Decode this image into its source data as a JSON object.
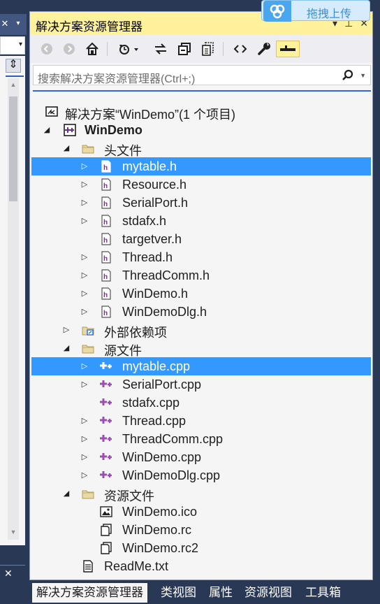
{
  "explorer": {
    "title": "解决方案资源管理器",
    "title_buttons": [
      "▾",
      "⊥",
      "✕"
    ],
    "search_placeholder": "搜索解决方案资源管理器(Ctrl+;)"
  },
  "overlay": {
    "upload_label": "拖拽上传"
  },
  "tree": [
    {
      "label": "解决方案“WinDemo”(1 个项目)",
      "icon": "solution-icon",
      "expand": "",
      "selected": false,
      "bold": false
    },
    {
      "label": "WinDemo",
      "icon": "project-icon",
      "expand": "◢",
      "selected": false,
      "bold": true
    },
    {
      "label": "头文件",
      "icon": "folder-icon",
      "expand": "◢",
      "selected": false,
      "bold": false
    },
    {
      "label": "mytable.h",
      "icon": "header-file-icon",
      "expand": "▷",
      "selected": true,
      "bold": false
    },
    {
      "label": "Resource.h",
      "icon": "header-file-icon",
      "expand": "▷",
      "selected": false,
      "bold": false
    },
    {
      "label": "SerialPort.h",
      "icon": "header-file-icon",
      "expand": "▷",
      "selected": false,
      "bold": false
    },
    {
      "label": "stdafx.h",
      "icon": "header-file-icon",
      "expand": "▷",
      "selected": false,
      "bold": false
    },
    {
      "label": "targetver.h",
      "icon": "header-file-icon",
      "expand": "",
      "selected": false,
      "bold": false
    },
    {
      "label": "Thread.h",
      "icon": "header-file-icon",
      "expand": "▷",
      "selected": false,
      "bold": false
    },
    {
      "label": "ThreadComm.h",
      "icon": "header-file-icon",
      "expand": "▷",
      "selected": false,
      "bold": false
    },
    {
      "label": "WinDemo.h",
      "icon": "header-file-icon",
      "expand": "▷",
      "selected": false,
      "bold": false
    },
    {
      "label": "WinDemoDlg.h",
      "icon": "header-file-icon",
      "expand": "▷",
      "selected": false,
      "bold": false
    },
    {
      "label": "外部依赖项",
      "icon": "external-deps-icon",
      "expand": "▷",
      "selected": false,
      "bold": false
    },
    {
      "label": "源文件",
      "icon": "folder-icon",
      "expand": "◢",
      "selected": false,
      "bold": false
    },
    {
      "label": "mytable.cpp",
      "icon": "cpp-file-icon",
      "expand": "▷",
      "selected": true,
      "bold": false
    },
    {
      "label": "SerialPort.cpp",
      "icon": "cpp-file-icon",
      "expand": "▷",
      "selected": false,
      "bold": false
    },
    {
      "label": "stdafx.cpp",
      "icon": "cpp-file-icon",
      "expand": "",
      "selected": false,
      "bold": false
    },
    {
      "label": "Thread.cpp",
      "icon": "cpp-file-icon",
      "expand": "▷",
      "selected": false,
      "bold": false
    },
    {
      "label": "ThreadComm.cpp",
      "icon": "cpp-file-icon",
      "expand": "▷",
      "selected": false,
      "bold": false
    },
    {
      "label": "WinDemo.cpp",
      "icon": "cpp-file-icon",
      "expand": "▷",
      "selected": false,
      "bold": false
    },
    {
      "label": "WinDemoDlg.cpp",
      "icon": "cpp-file-icon",
      "expand": "▷",
      "selected": false,
      "bold": false
    },
    {
      "label": "资源文件",
      "icon": "folder-icon",
      "expand": "◢",
      "selected": false,
      "bold": false
    },
    {
      "label": "WinDemo.ico",
      "icon": "image-file-icon",
      "expand": "",
      "selected": false,
      "bold": false
    },
    {
      "label": "WinDemo.rc",
      "icon": "resource-file-icon",
      "expand": "",
      "selected": false,
      "bold": false
    },
    {
      "label": "WinDemo.rc2",
      "icon": "resource-file-icon",
      "expand": "",
      "selected": false,
      "bold": false
    },
    {
      "label": "ReadMe.txt",
      "icon": "text-file-icon",
      "expand": "",
      "selected": false,
      "bold": false
    }
  ],
  "tabs": [
    {
      "label": "解决方案资源管理器",
      "active": true
    },
    {
      "label": "类视图",
      "active": false
    },
    {
      "label": "属性",
      "active": false
    },
    {
      "label": "资源视图",
      "active": false
    },
    {
      "label": "工具箱",
      "active": false
    }
  ],
  "colors": {
    "title_bar": "#fff29d",
    "selection": "#3399ff",
    "frame": "#293955",
    "header_icon": "#7b2d8f",
    "cpp_icon": "#9b4fb0"
  }
}
